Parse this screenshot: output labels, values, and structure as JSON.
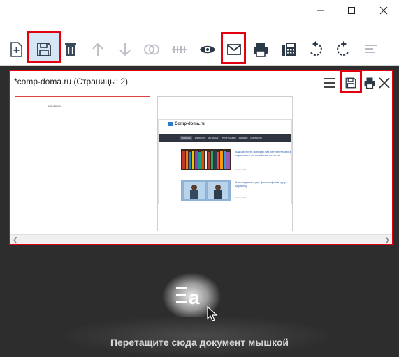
{
  "window": {
    "controls": [
      "minimize",
      "maximize",
      "close"
    ]
  },
  "toolbar": {
    "buttons": [
      {
        "name": "new-document",
        "icon": "file-plus-icon",
        "highlighted": false
      },
      {
        "name": "save",
        "icon": "floppy-disk-icon",
        "highlighted": true
      },
      {
        "name": "delete",
        "icon": "trash-icon",
        "highlighted": false
      },
      {
        "name": "move-up",
        "icon": "arrow-up-icon",
        "enabled": false
      },
      {
        "name": "move-down",
        "icon": "arrow-down-icon",
        "enabled": false
      },
      {
        "name": "merge",
        "icon": "overlap-circles-icon",
        "enabled": false
      },
      {
        "name": "split",
        "icon": "split-icon",
        "enabled": false
      },
      {
        "name": "preview",
        "icon": "eye-icon"
      },
      {
        "name": "email",
        "icon": "envelope-icon",
        "highlighted": true
      },
      {
        "name": "print",
        "icon": "printer-icon"
      },
      {
        "name": "fax",
        "icon": "fax-icon"
      },
      {
        "name": "rotate-left",
        "icon": "rotate-left-icon"
      },
      {
        "name": "rotate-right",
        "icon": "rotate-right-icon"
      },
      {
        "name": "align",
        "icon": "align-left-icon",
        "enabled": false
      }
    ],
    "accent": "#e3000f",
    "highlight_fill": "#d6e6f5"
  },
  "document": {
    "title": "*comp-doma.ru (Страницы: 2)",
    "panel_buttons": [
      "menu-icon",
      "floppy-disk-icon",
      "printer-icon",
      "close-icon"
    ],
    "pages": [
      {
        "label": "page-1",
        "text": "comp-doma.ru"
      },
      {
        "label": "page-2",
        "site_name": "Comp-doma.ru",
        "nav": [
          "ГЛАВНАЯ",
          "WINDOWS",
          "ИНТЕРНЕТ",
          "ПРОГРАММЫ",
          "ЖЕЛЕЗО",
          "КОНТАКТЫ"
        ],
        "articles": [
          {
            "title": "Как смотреть фильмы без интернета и без надоевшей на онлайн-кинотеатры",
            "date": "10.03.2019"
          },
          {
            "title": "Как соединить две фотографии в одну картинку",
            "date": "10.03.2019"
          }
        ]
      }
    ]
  },
  "dropzone": {
    "text": "Перетащите сюда документ мышкой"
  }
}
